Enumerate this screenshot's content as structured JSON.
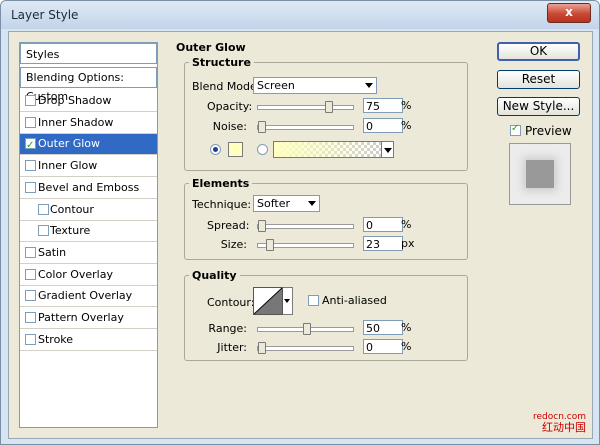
{
  "window": {
    "title": "Layer Style",
    "close_glyph": "x"
  },
  "styles": {
    "header": "Styles",
    "blending_options": "Blending Options: Custom",
    "items": [
      {
        "label": "Drop Shadow",
        "checked": false,
        "sub": false,
        "active": false
      },
      {
        "label": "Inner Shadow",
        "checked": false,
        "sub": false,
        "active": false
      },
      {
        "label": "Outer Glow",
        "checked": true,
        "sub": false,
        "active": true
      },
      {
        "label": "Inner Glow",
        "checked": false,
        "sub": false,
        "active": false
      },
      {
        "label": "Bevel and Emboss",
        "checked": false,
        "sub": false,
        "active": false
      },
      {
        "label": "Contour",
        "checked": false,
        "sub": true,
        "active": false
      },
      {
        "label": "Texture",
        "checked": false,
        "sub": true,
        "active": false
      },
      {
        "label": "Satin",
        "checked": false,
        "sub": false,
        "active": false
      },
      {
        "label": "Color Overlay",
        "checked": false,
        "sub": false,
        "active": false
      },
      {
        "label": "Gradient Overlay",
        "checked": false,
        "sub": false,
        "active": false
      },
      {
        "label": "Pattern Overlay",
        "checked": false,
        "sub": false,
        "active": false
      },
      {
        "label": "Stroke",
        "checked": false,
        "sub": false,
        "active": false
      }
    ]
  },
  "outer_glow": {
    "title": "Outer Glow",
    "structure": {
      "title": "Structure",
      "blend_mode_label": "Blend Mode:",
      "blend_mode_value": "Screen",
      "opacity_label": "Opacity:",
      "opacity_value": "75",
      "opacity_unit": "%",
      "noise_label": "Noise:",
      "noise_value": "0",
      "noise_unit": "%",
      "glow_color": "#ffffc0"
    },
    "elements": {
      "title": "Elements",
      "technique_label": "Technique:",
      "technique_value": "Softer",
      "spread_label": "Spread:",
      "spread_value": "0",
      "spread_unit": "%",
      "size_label": "Size:",
      "size_value": "23",
      "size_unit": "px"
    },
    "quality": {
      "title": "Quality",
      "contour_label": "Contour:",
      "anti_aliased_label": "Anti-aliased",
      "anti_aliased_checked": false,
      "range_label": "Range:",
      "range_value": "50",
      "range_unit": "%",
      "jitter_label": "Jitter:",
      "jitter_value": "0",
      "jitter_unit": "%"
    }
  },
  "buttons": {
    "ok": "OK",
    "reset": "Reset",
    "new_style": "New Style..."
  },
  "preview": {
    "label": "Preview",
    "checked": true
  },
  "watermark": {
    "line1": "redocn.com",
    "line2": "红动中国"
  }
}
